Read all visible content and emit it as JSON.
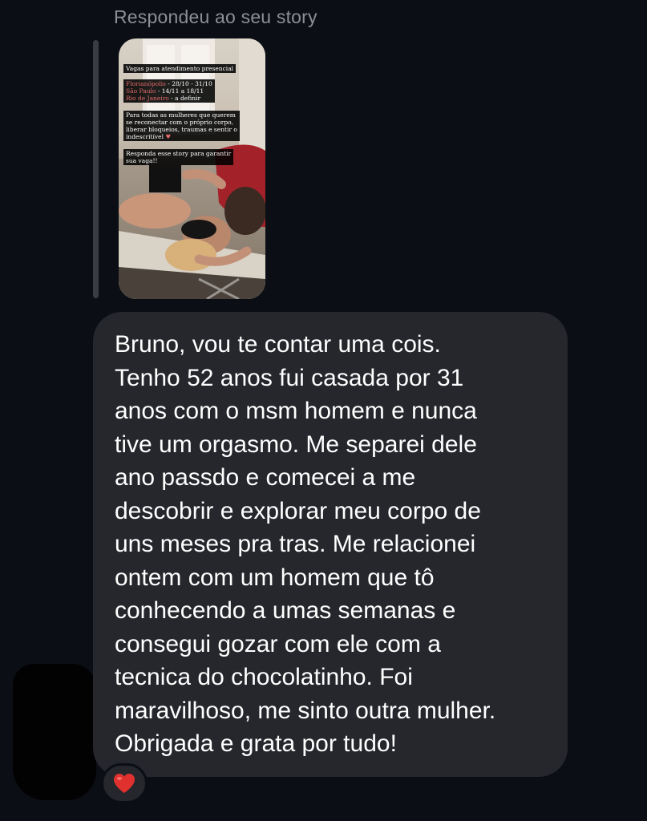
{
  "reply_context": {
    "label": "Respondeu ao seu story"
  },
  "story": {
    "title": "Vagas para atendimento presencial",
    "cities": [
      {
        "name": "Florianópolis",
        "dates": " - 28/10 - 31/10"
      },
      {
        "name": "São Paulo",
        "dates": " - 14/11 a 18/11"
      },
      {
        "name": "Rio de Janeiro",
        "dates": " - a definir"
      }
    ],
    "body_lines": [
      "Para todas as mulheres que querem",
      "se reconectar com o próprio corpo,",
      "liberar bloqueios, traumas e sentir o",
      "indescritível"
    ],
    "cta_lines": [
      "Responda esse story para garantir",
      "sua vaga!!"
    ]
  },
  "message": {
    "text": "Bruno, vou te contar uma cois.\nTenho 52 anos fui casada por 31\nanos com o msm homem e nunca\ntive um orgasmo. Me separei dele\nano passdo e comecei a me\ndescobrir e explorar meu corpo de\nuns meses pra tras. Me relacionei\nontem com um homem que tô\nconhecendo a umas semanas e\nconsegui gozar com ele com a\ntecnica do chocolatinho. Foi\nmaravilhoso, me sinto outra mulher.\nObrigada e grata por tudo!"
  },
  "reaction": {
    "icon": "red-heart-icon",
    "color": "#e0312f"
  },
  "colors": {
    "background": "#0b0e14",
    "bubble": "#25272d",
    "muted_text": "#8e8f94"
  }
}
